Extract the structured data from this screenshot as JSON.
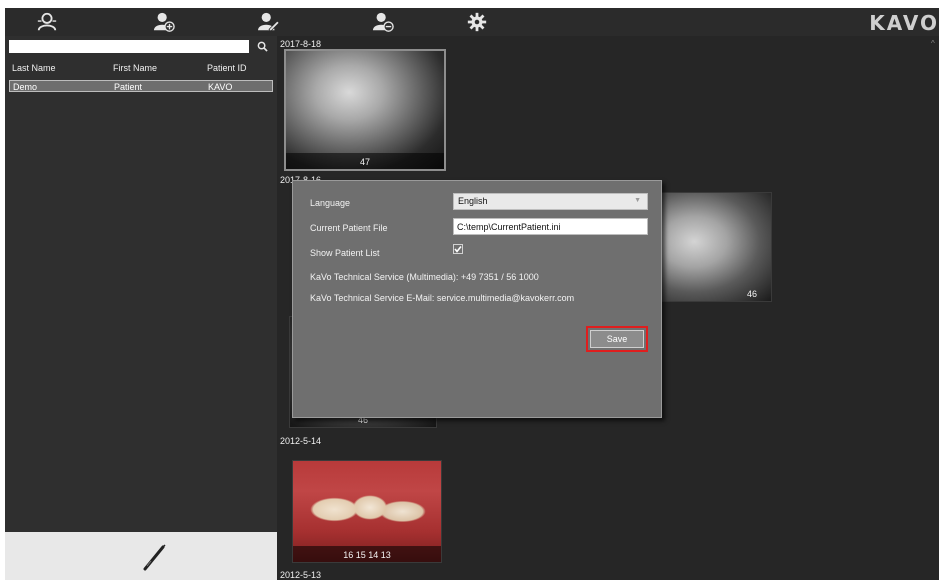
{
  "toolbar": {
    "icons": [
      "patients-icon",
      "add-patient-icon",
      "edit-patient-icon",
      "remove-patient-icon",
      "settings-icon"
    ],
    "brand": "KAVO"
  },
  "sidebar": {
    "search": {
      "value": "",
      "placeholder": ""
    },
    "columns": [
      "Last Name",
      "First Name",
      "Patient ID"
    ],
    "patients": [
      {
        "last_name": "Demo",
        "first_name": "Patient",
        "patient_id": "KAVO"
      }
    ]
  },
  "content": {
    "groups": [
      {
        "date": "2017-8-18",
        "images": [
          {
            "label": "47"
          }
        ]
      },
      {
        "date": "2017-8-16",
        "images": [
          {
            "label": "46"
          },
          {
            "label": "46"
          }
        ]
      },
      {
        "date": "2012-5-14",
        "images": [
          {
            "label": "16 15 14 13"
          }
        ]
      },
      {
        "date": "2012-5-13",
        "images": []
      }
    ]
  },
  "settings_dialog": {
    "language_label": "Language",
    "language_value": "English",
    "patient_file_label": "Current Patient File",
    "patient_file_value": "C:\\temp\\CurrentPatient.ini",
    "show_list_label": "Show Patient List",
    "show_list_checked": true,
    "service_phone": "KaVo Technical Service (Multimedia): +49 7351 / 56 1000",
    "service_email": "KaVo Technical Service E-Mail: service.multimedia@kavokerr.com",
    "save_label": "Save"
  },
  "colors": {
    "background": "#262626",
    "sidebar": "#2f2f2f",
    "dialog": "#6f6f6f",
    "highlight": "#e01e1e"
  }
}
